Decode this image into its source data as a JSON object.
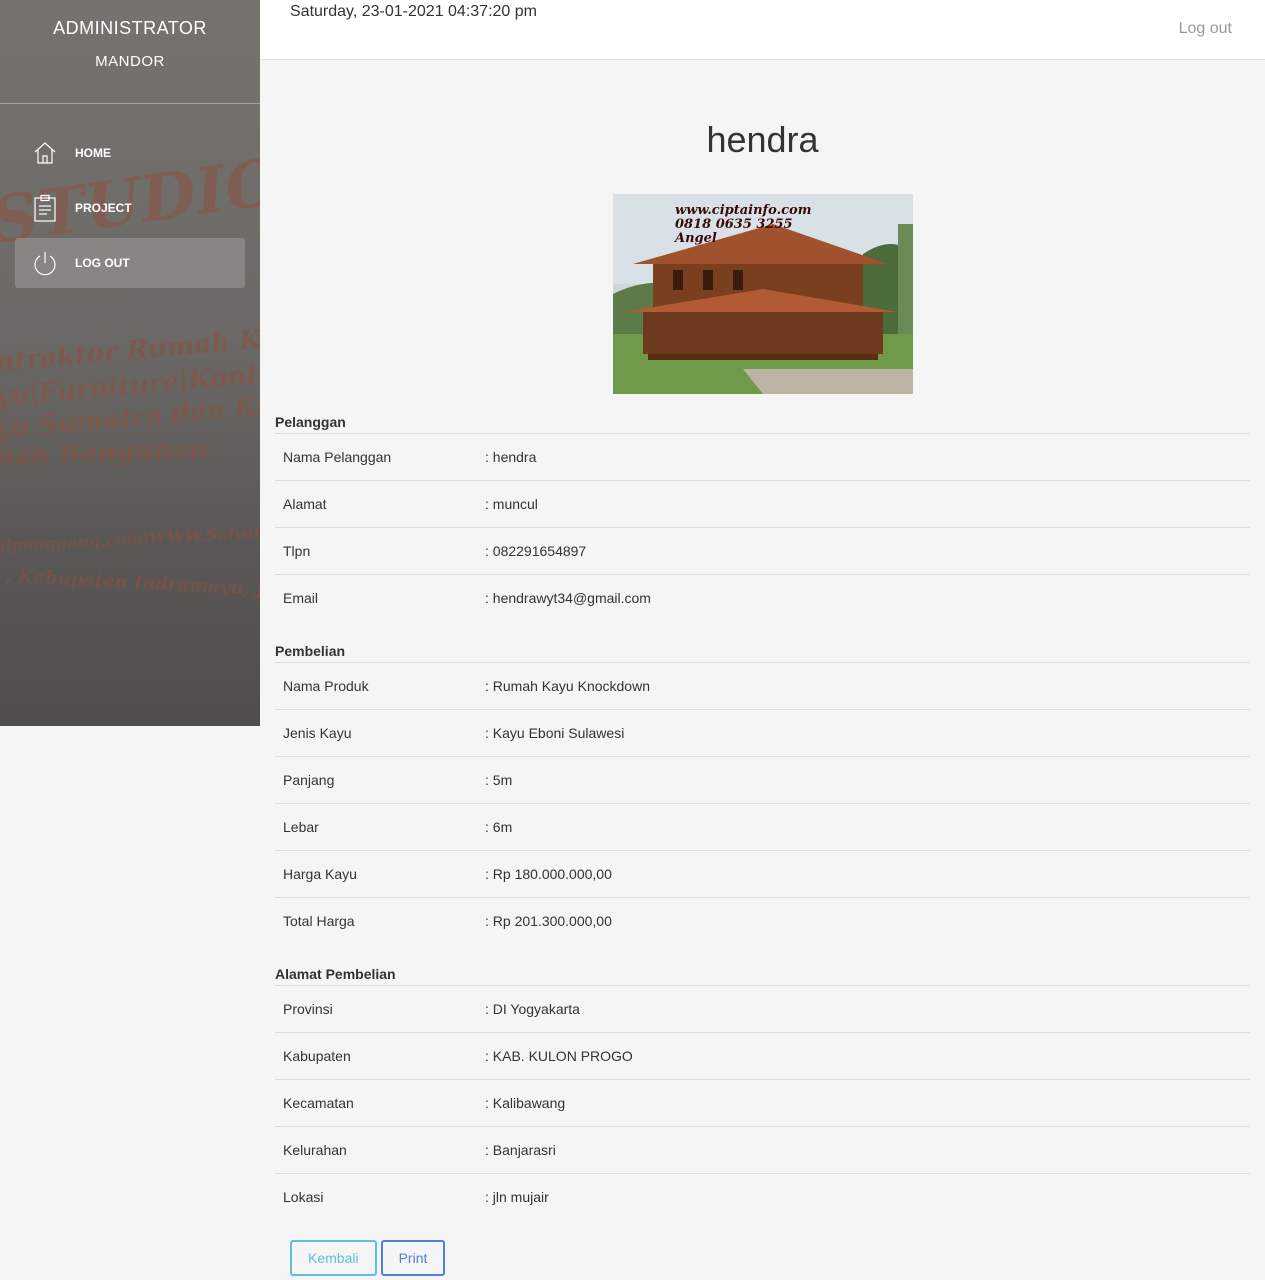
{
  "sidebar": {
    "role_title": "ADMINISTRATOR",
    "role_subtitle": "MANDOR",
    "items": [
      {
        "label": "HOME",
        "icon": "home-icon"
      },
      {
        "label": "PROJECT",
        "icon": "clipboard-icon"
      },
      {
        "label": "LOG OUT",
        "icon": "power-icon"
      }
    ]
  },
  "topbar": {
    "datetime": "Saturday, 23-01-2021 04:37:20 pm",
    "logout_label": "Log out"
  },
  "main": {
    "title": "hendra",
    "photo_caption": [
      "www.ciptainfo.com",
      "0818 0635 3255",
      "Angel"
    ],
    "sections": [
      {
        "title": "Pelanggan",
        "rows": [
          {
            "label": "Nama Pelanggan",
            "value": ": hendra"
          },
          {
            "label": "Alamat",
            "value": ": muncul"
          },
          {
            "label": "Tlpn",
            "value": ": 082291654897"
          },
          {
            "label": "Email",
            "value": ": hendrawyt34@gmail.com"
          }
        ]
      },
      {
        "title": "Pembelian",
        "rows": [
          {
            "label": "Nama Produk",
            "value": ": Rumah Kayu Knockdown"
          },
          {
            "label": "Jenis Kayu",
            "value": ": Kayu Eboni Sulawesi"
          },
          {
            "label": "Panjang",
            "value": ": 5m"
          },
          {
            "label": "Lebar",
            "value": ": 6m"
          },
          {
            "label": "Harga Kayu",
            "value": ": Rp 180.000.000,00"
          },
          {
            "label": "Total Harga",
            "value": ": Rp 201.300.000,00"
          }
        ]
      },
      {
        "title": "Alamat Pembelian",
        "rows": [
          {
            "label": "Provinsi",
            "value": ": DI Yogyakarta"
          },
          {
            "label": "Kabupaten",
            "value": ": KAB. KULON PROGO"
          },
          {
            "label": "Kecamatan",
            "value": ": Kalibawang"
          },
          {
            "label": "Kelurahan",
            "value": ": Banjarasri"
          },
          {
            "label": "Lokasi",
            "value": ": jln mujair"
          }
        ]
      }
    ],
    "buttons": {
      "back_label": "Kembali",
      "print_label": "Print"
    }
  }
}
